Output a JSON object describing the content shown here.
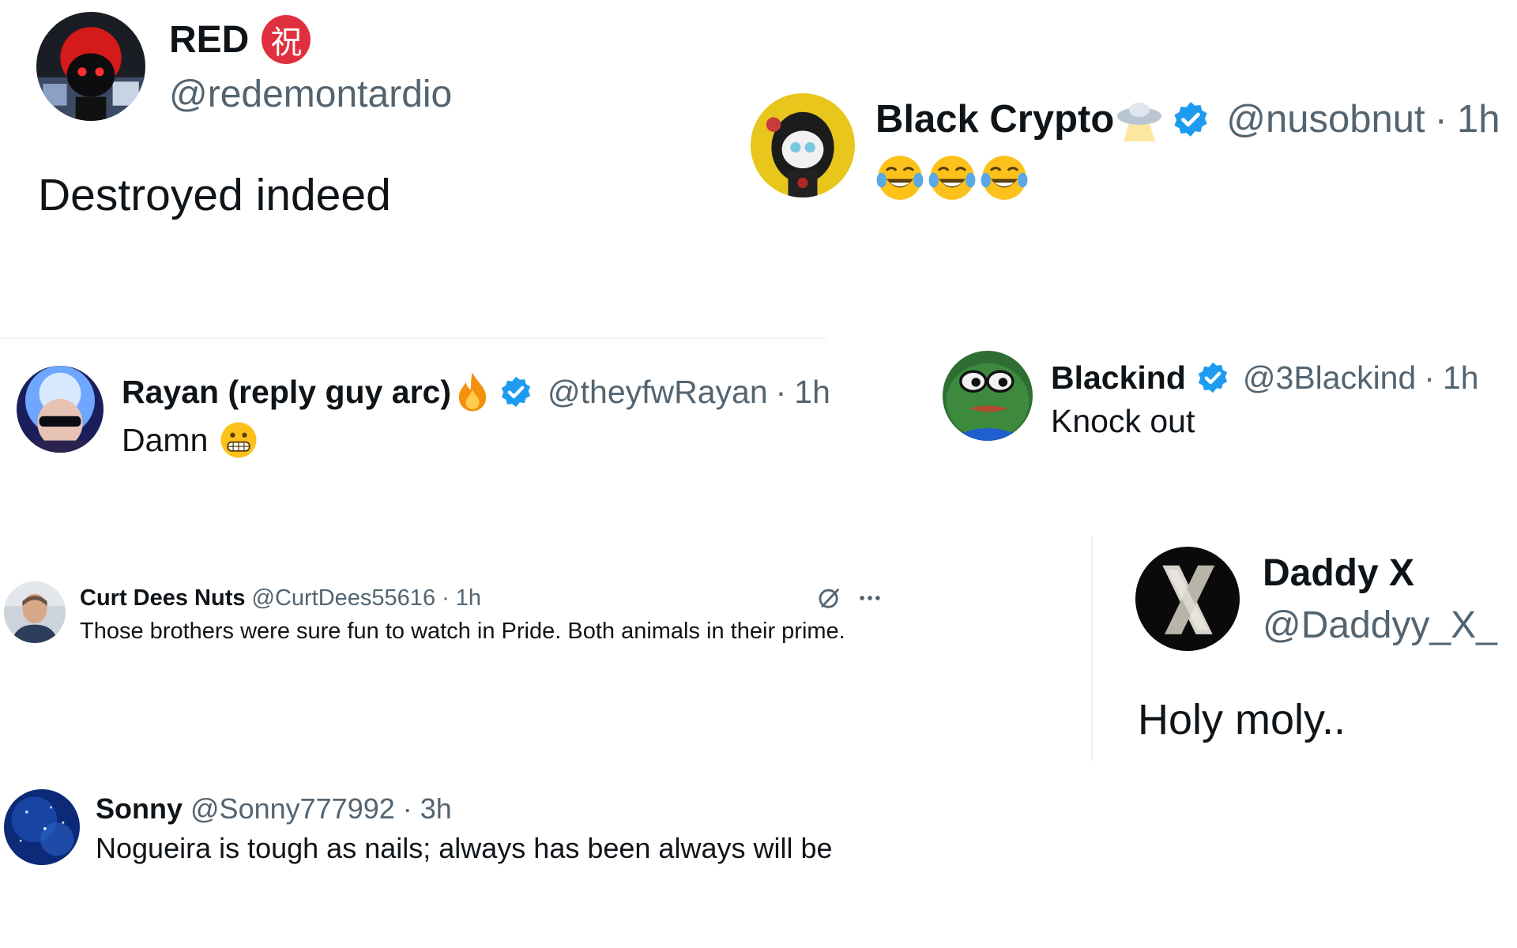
{
  "posts": {
    "red": {
      "name": "RED",
      "badge": "祝",
      "handle": "@redemontardio",
      "text": "Destroyed indeed"
    },
    "black_crypto": {
      "name": "Black Crypto",
      "handle": "@nusobnut",
      "time": "1h",
      "text_emojis": [
        "laughing-tears-emoji",
        "laughing-tears-emoji",
        "laughing-tears-emoji"
      ]
    },
    "rayan": {
      "name": "Rayan (reply guy arc)",
      "handle": "@theyfwRayan",
      "time": "1h",
      "text": "Damn"
    },
    "blackind": {
      "name": "Blackind",
      "handle": "@3Blackind",
      "time": "1h",
      "text": "Knock out"
    },
    "curt": {
      "name": "Curt Dees Nuts",
      "handle": "@CurtDees55616",
      "time": "1h",
      "text": "Those brothers were sure fun to watch in Pride. Both animals in their prime."
    },
    "daddy_x": {
      "name": "Daddy X",
      "handle": "@Daddyy_X_",
      "text": "Holy moly.."
    },
    "sonny": {
      "name": "Sonny",
      "handle": "@Sonny777992",
      "time": "3h",
      "text": "Nogueira is tough as nails; always has been always will be"
    }
  },
  "separator": "·",
  "colors": {
    "verified_blue": "#1d9bf0",
    "handle_gray": "#536471",
    "badge_red": "#e0303f"
  }
}
